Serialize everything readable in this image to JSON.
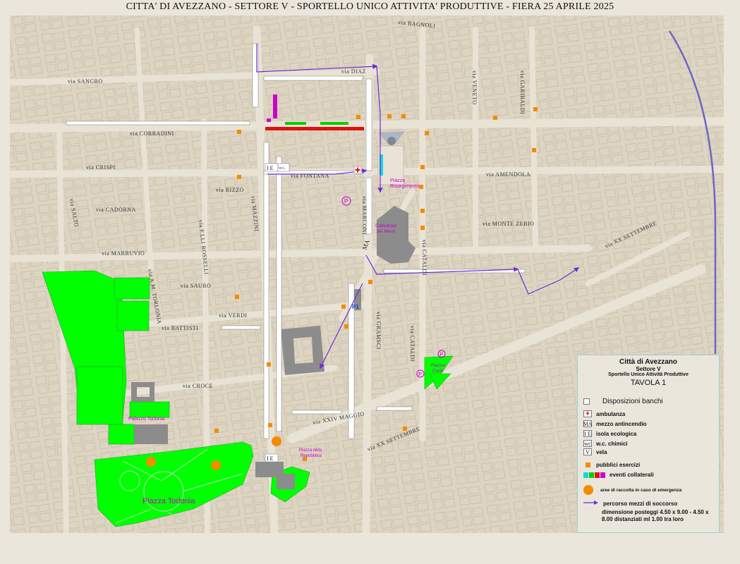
{
  "title": "CITTA' DI AVEZZANO - SETTORE V - SPORTELLO UNICO ATTIVITA' PRODUTTIVE  - FIERA 25 APRILE 2025",
  "colors": {
    "background": "#eae6dc",
    "map": "#ddd4c2",
    "green_area": "#00ff00",
    "building_gray": "#8c8c8c",
    "route_purple": "#6c2bd9",
    "shop_orange": "#f28c00",
    "magenta": "#cc00cc",
    "cyan": "#16d6e0",
    "red": "#e01010"
  },
  "streets": {
    "bagnoli": "via BAGNOLI",
    "sangro": "via SANGRO",
    "diaz": "via DIAZ",
    "corradini": "via CORRADINI",
    "crispi": "via CRISPI",
    "salto": "via SALTO",
    "cadorna": "via CADORNA",
    "rizzo": "via RIZZO",
    "fontana": "via FONTANA",
    "mazzini": "via MAZZINI",
    "marconi": "via MARCONI",
    "fratelli_rosselli": "via F.LLI ROSSELLI",
    "marruvio": "via MARRUVIO",
    "am_torlonia": "via A.M. TORLONIA",
    "sauro": "via SAURO",
    "verdi": "via VERDI",
    "battisti": "via BATTISTI",
    "croce": "via CROCE",
    "xxiv_maggio": "via XXIV MAGGIO",
    "xx_settembre_s": "via XX SETTEMBRE",
    "xx_settembre_e": "via XX SETTEMBRE",
    "gramsci": "via GRAMSCI",
    "cataldi_n": "via CATALDI",
    "cataldi_s": "via CATALDI",
    "amendola": "via AMENDOLA",
    "montezebio": "via MONTE ZEBIO",
    "veneto": "via VENETO",
    "garibaldi": "via GARIBALDI"
  },
  "places": {
    "piazza_risorgimento": [
      "Piazza",
      "Risorgimento"
    ],
    "cattedrale": [
      "Cattedrale",
      "dei Marsi"
    ],
    "palazzo_torlonia": "Palazzo Torlonia",
    "piazza_torlonia": "Piazza Torlonia",
    "piazza_repubblica": [
      "Piazza della",
      "Repubblica"
    ],
    "piazza_corbi": [
      "Piazza",
      "Corbi"
    ],
    "parking_p": "P",
    "p1": "P1"
  },
  "map_codes": {
    "ie": "I E",
    "wc": "W.C.",
    "ma": "MA"
  },
  "legend": {
    "city": "Città  di  Avezzano",
    "sector": "Settore V",
    "office": "Sportello Unico Attività Produttive",
    "table": "TAVOLA 1",
    "items": [
      {
        "symbol": "box",
        "label": "Disposizioni banchi"
      },
      {
        "symbol": "cross",
        "label": "ambulanza"
      },
      {
        "symbol": "MA",
        "label": "mezzo antincendio"
      },
      {
        "symbol": "I E",
        "label": "isola ecologica"
      },
      {
        "symbol": "wc",
        "label": "w.c. chimici"
      },
      {
        "symbol": "V",
        "label": "vela"
      },
      {
        "symbol": "orange-square",
        "label": "pubblici esercizi"
      },
      {
        "symbol": "color-strip",
        "label": "eventi collaterali"
      },
      {
        "symbol": "orange-circle",
        "label": "aree di raccolta  in caso di emergenza"
      },
      {
        "symbol": "arrow",
        "label": "percorso mezzi di soccorso"
      }
    ],
    "note": "dimensione posteggi 4.50 x 9.00 - 4.50 x 8.00 distanziati ml 1.00 tra loro"
  }
}
